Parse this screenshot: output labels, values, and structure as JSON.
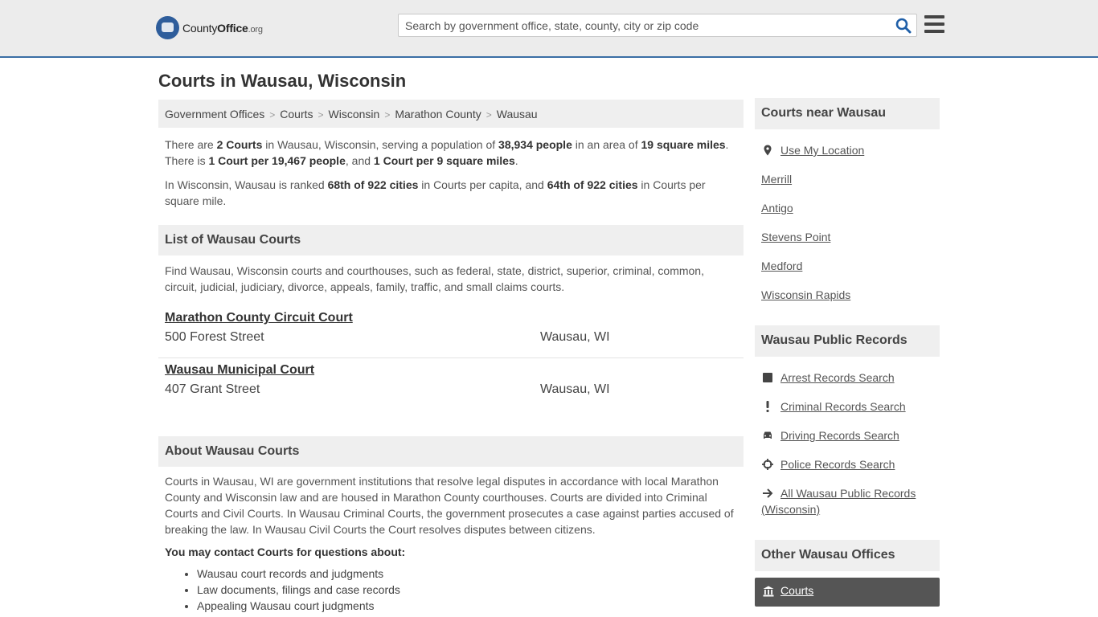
{
  "header": {
    "logo": {
      "county": "County",
      "office": "Office",
      "org": ".org"
    },
    "search_placeholder": "Search by government office, state, county, city or zip code"
  },
  "page_title": "Courts in Wausau, Wisconsin",
  "breadcrumb": [
    "Government Offices",
    "Courts",
    "Wisconsin",
    "Marathon County",
    "Wausau"
  ],
  "intro": {
    "p1": {
      "t1": "There are ",
      "b1": "2 Courts",
      "t2": " in Wausau, Wisconsin, serving a population of ",
      "b2": "38,934 people",
      "t3": " in an area of ",
      "b3": "19 square miles",
      "t4": ". There is ",
      "b4": "1 Court per 19,467 people",
      "t5": ", and ",
      "b5": "1 Court per 9 square miles",
      "t6": "."
    },
    "p2": {
      "t1": "In Wisconsin, Wausau is ranked ",
      "b1": "68th of 922 cities",
      "t2": " in Courts per capita, and ",
      "b2": "64th of 922 cities",
      "t3": " in Courts per square mile."
    }
  },
  "list_section": {
    "title": "List of Wausau Courts",
    "description": "Find Wausau, Wisconsin courts and courthouses, such as federal, state, district, superior, criminal, common, circuit, judicial, judiciary, divorce, appeals, family, traffic, and small claims courts.",
    "courts": [
      {
        "name": "Marathon County Circuit Court",
        "address": "500 Forest Street",
        "city": "Wausau, WI"
      },
      {
        "name": "Wausau Municipal Court",
        "address": "407 Grant Street",
        "city": "Wausau, WI"
      }
    ]
  },
  "about_section": {
    "title": "About Wausau Courts",
    "text": "Courts in Wausau, WI are government institutions that resolve legal disputes in accordance with local Marathon County and Wisconsin law and are housed in Marathon County courthouses. Courts are divided into Criminal Courts and Civil Courts. In Wausau Criminal Courts, the government prosecutes a case against parties accused of breaking the law. In Wausau Civil Courts the Court resolves disputes between citizens.",
    "contact_head": "You may contact Courts for questions about:",
    "topics": [
      "Wausau court records and judgments",
      "Law documents, filings and case records",
      "Appealing Wausau court judgments"
    ]
  },
  "sidebar": {
    "nearby": {
      "title": "Courts near Wausau",
      "use_location": "Use My Location",
      "cities": [
        "Merrill",
        "Antigo",
        "Stevens Point",
        "Medford",
        "Wisconsin Rapids"
      ]
    },
    "records": {
      "title": "Wausau Public Records",
      "items": [
        "Arrest Records Search",
        "Criminal Records Search",
        "Driving Records Search",
        "Police Records Search",
        "All Wausau Public Records (Wisconsin)"
      ]
    },
    "other": {
      "title": "Other Wausau Offices",
      "active": "Courts"
    }
  },
  "colors": {
    "accent": "#3a6ea5",
    "search_icon": "#1f5fa8"
  }
}
